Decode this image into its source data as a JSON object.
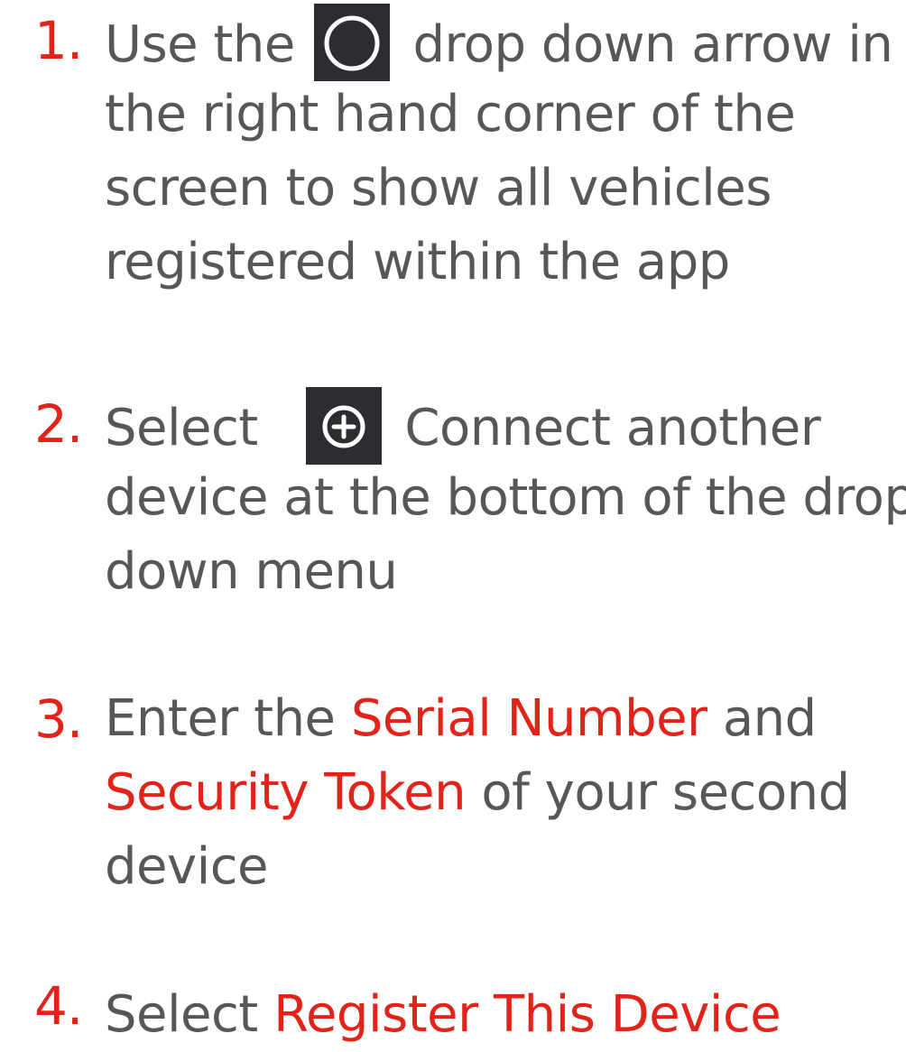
{
  "steps": [
    {
      "number": "1.",
      "lines": [
        {
          "before": "Use the",
          "icon": "circle-icon",
          "after": "drop down arrow in"
        },
        {
          "text": "the right hand corner of the"
        },
        {
          "text": "screen to show all vehicles"
        },
        {
          "text": "registered within the app"
        }
      ]
    },
    {
      "number": "2.",
      "lines": [
        {
          "before": "Select",
          "icon": "plus-circle-icon",
          "after": "Connect another"
        },
        {
          "text": "device at the bottom of the drop"
        },
        {
          "text": "down menu"
        }
      ]
    },
    {
      "number": "3.",
      "lines": [
        {
          "before": "Enter the",
          "highlight": "Serial Number",
          "after": "and"
        },
        {
          "highlight": "Security Token",
          "after": "of your second"
        },
        {
          "text": "device"
        }
      ]
    },
    {
      "number": "4.",
      "lines": [
        {
          "before": "Select",
          "highlight": "Register This Device"
        }
      ]
    }
  ],
  "colors": {
    "accent": "#e2231a",
    "text": "#575757",
    "icon_bg": "#2b2d31"
  }
}
